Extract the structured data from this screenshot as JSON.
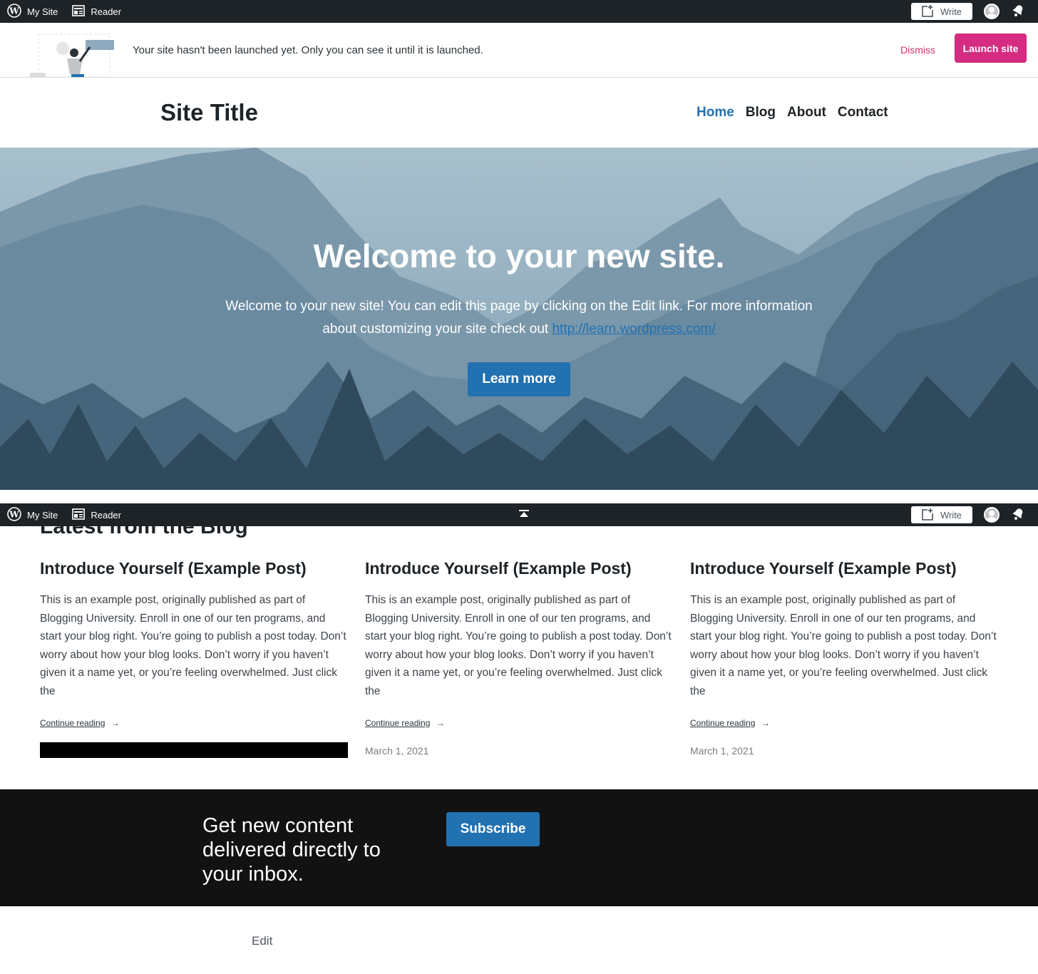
{
  "adminbar": {
    "my_site": "My Site",
    "reader": "Reader",
    "write": "Write"
  },
  "launch_banner": {
    "message": "Your site hasn't been launched yet. Only you can see it until it is launched.",
    "dismiss": "Dismiss",
    "launch": "Launch site"
  },
  "site": {
    "title": "Site Title",
    "nav": [
      {
        "label": "Home",
        "active": true
      },
      {
        "label": "Blog",
        "active": false
      },
      {
        "label": "About",
        "active": false
      },
      {
        "label": "Contact",
        "active": false
      }
    ]
  },
  "hero": {
    "title": "Welcome to your new site.",
    "body_prefix": "Welcome to your new site! You can edit this page by clicking on the Edit link. For more information about customizing your site check out",
    "link": "http://learn.wordpress.com/",
    "button": "Learn more"
  },
  "blog": {
    "heading": "Latest from the Blog",
    "posts": [
      {
        "title": "Introduce Yourself (Example Post)",
        "excerpt": "This is an example post, originally published as part of Blogging University. Enroll in one of our ten programs, and start your blog right. You’re going to publish a post today. Don’t worry about how your blog looks. Don’t worry if you haven’t given it a name yet, or you’re feeling overwhelmed. Just click the",
        "continue": "Continue reading",
        "arrow": "→",
        "date": ""
      },
      {
        "title": "Introduce Yourself (Example Post)",
        "excerpt": "This is an example post, originally published as part of Blogging University. Enroll in one of our ten programs, and start your blog right. You’re going to publish a post today. Don’t worry about how your blog looks. Don’t worry if you haven’t given it a name yet, or you’re feeling overwhelmed. Just click the",
        "continue": "Continue reading",
        "arrow": "→",
        "date": "March 1, 2021"
      },
      {
        "title": "Introduce Yourself (Example Post)",
        "excerpt": "This is an example post, originally published as part of Blogging University. Enroll in one of our ten programs, and start your blog right. You’re going to publish a post today. Don’t worry about how your blog looks. Don’t worry if you haven’t given it a name yet, or you’re feeling overwhelmed. Just click the",
        "continue": "Continue reading",
        "arrow": "→",
        "date": "March 1, 2021"
      }
    ]
  },
  "subscribe": {
    "text": "Get new content delivered directly to your inbox.",
    "button": "Subscribe"
  },
  "footer": {
    "edit": "Edit"
  },
  "colors": {
    "accent": "#2271b1",
    "launch": "#d52c82",
    "adminbar": "#1d2327"
  }
}
